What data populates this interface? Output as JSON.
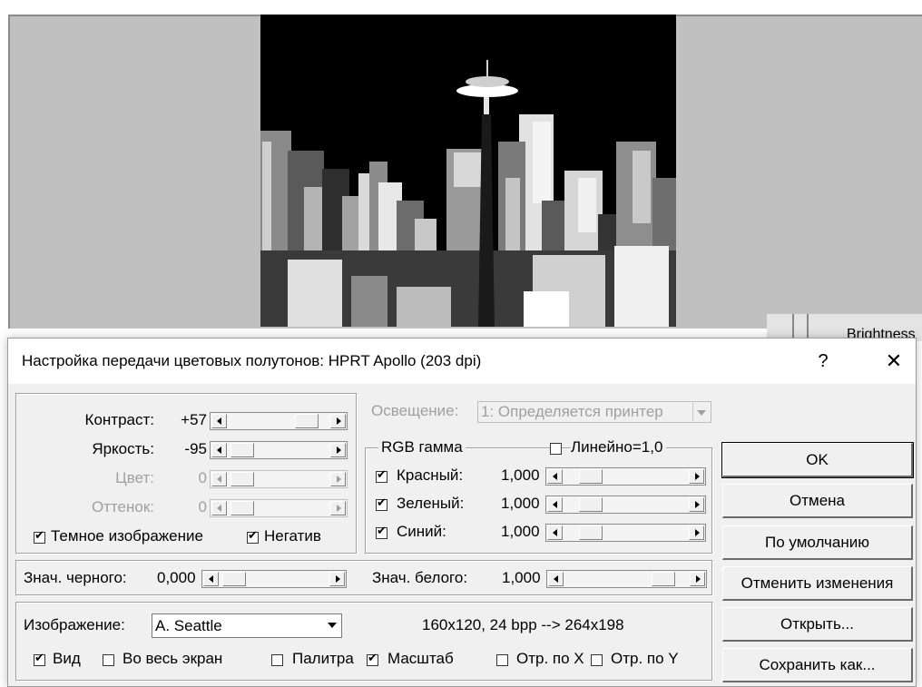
{
  "dialog": {
    "title": "Настройка передачи цветовых полутонов: HPRT Apollo (203 dpi)",
    "help": "?",
    "close": "✕"
  },
  "behind_window": {
    "text": "Brightness"
  },
  "adjust": {
    "contrast": {
      "label": "Контраст:",
      "value": "+57",
      "level": 0.78
    },
    "brightness": {
      "label": "Яркость:",
      "value": "-95",
      "level": 0.03
    },
    "color": {
      "label": "Цвет:",
      "value": "0"
    },
    "hue": {
      "label": "Оттенок:",
      "value": "0"
    },
    "dark_image": {
      "label": "Темное изображение",
      "checked": true
    },
    "negative": {
      "label": "Негатив",
      "checked": true
    }
  },
  "illumination": {
    "label": "Освещение:",
    "value": "1: Определяется принтер"
  },
  "rgb_gamma": {
    "label": "RGB гамма",
    "linear": {
      "label": "Линейно=1,0",
      "checked": false
    },
    "red": {
      "label": "Красный:",
      "value": "1,000",
      "checked": true
    },
    "green": {
      "label": "Зеленый:",
      "value": "1,000",
      "checked": true
    },
    "blue": {
      "label": "Синий:",
      "value": "1,000",
      "checked": true
    }
  },
  "levels": {
    "black": {
      "label": "Знач. черного:",
      "value": "0,000"
    },
    "white": {
      "label": "Знач. белого:",
      "value": "1,000"
    }
  },
  "image": {
    "label": "Изображение:",
    "selected": "A. Seattle",
    "info": "160x120, 24 bpp  --> 264x198",
    "view": {
      "label": "Вид",
      "checked": true
    },
    "fullscreen": {
      "label": "Во весь экран",
      "checked": false
    },
    "palette": {
      "label": "Палитра",
      "checked": false
    },
    "scale": {
      "label": "Масштаб",
      "checked": true
    },
    "flip_x": {
      "label": "Отр. по X",
      "checked": false
    },
    "flip_y": {
      "label": "Отр. по Y",
      "checked": false
    }
  },
  "buttons": {
    "ok": "OK",
    "cancel": "Отмена",
    "default": "По умолчанию",
    "undo": "Отменить изменения",
    "open": "Открыть...",
    "save_as": "Сохранить как..."
  }
}
